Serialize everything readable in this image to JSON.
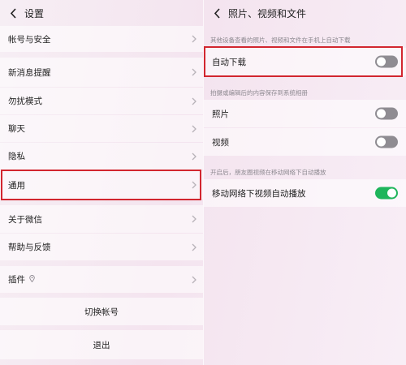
{
  "left": {
    "title": "设置",
    "items": [
      {
        "label": "帐号与安全"
      },
      {
        "label": "新消息提醒"
      },
      {
        "label": "勿扰模式"
      },
      {
        "label": "聊天"
      },
      {
        "label": "隐私"
      },
      {
        "label": "通用"
      },
      {
        "label": "关于微信"
      },
      {
        "label": "帮助与反馈"
      },
      {
        "label": "插件"
      }
    ],
    "switch_account": "切换帐号",
    "logout": "退出"
  },
  "right": {
    "title": "照片、视频和文件",
    "note1": "其他设备查看的照片、视频和文件在手机上自动下载",
    "auto_download": {
      "label": "自动下载",
      "on": false
    },
    "note2": "拍摄或编辑后的内容保存到系统相册",
    "photo": {
      "label": "照片",
      "on": false
    },
    "video": {
      "label": "视频",
      "on": false
    },
    "note3": "开启后，朋友圈视频在移动网络下自动播放",
    "mobile_autoplay": {
      "label": "移动网络下视频自动播放",
      "on": true
    }
  },
  "colors": {
    "highlight": "#d2262f",
    "toggle_on": "#1eb55b",
    "toggle_off": "#8f8c92"
  }
}
